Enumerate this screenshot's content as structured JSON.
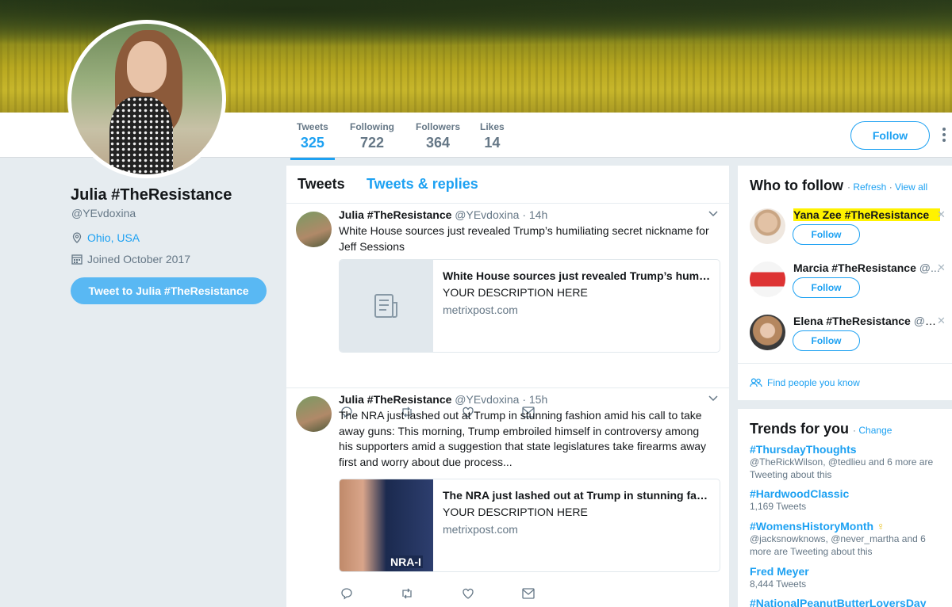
{
  "profile": {
    "name": "Julia #TheResistance",
    "handle": "@YEvdoxina",
    "location": "Ohio, USA",
    "joined": "Joined October 2017",
    "tweet_to_label": "Tweet to Julia #TheResistance"
  },
  "nav": {
    "stats": [
      {
        "label": "Tweets",
        "value": "325"
      },
      {
        "label": "Following",
        "value": "722"
      },
      {
        "label": "Followers",
        "value": "364"
      },
      {
        "label": "Likes",
        "value": "14"
      }
    ],
    "follow_label": "Follow",
    "more_icon": "more-vertical-icon"
  },
  "timeline": {
    "tabs": [
      "Tweets",
      "Tweets & replies"
    ],
    "tweets": [
      {
        "name": "Julia #TheResistance",
        "meta": "@YEvdoxina · 14h",
        "text": "White House sources just revealed Trump’s humiliating secret nickname for Jeff Sessions",
        "card": {
          "title": "White House sources just revealed Trump’s humiliating secret nickname for Jeff Sessions",
          "description": "YOUR DESCRIPTION HERE",
          "domain": "metrixpost.com"
        }
      },
      {
        "name": "Julia #TheResistance",
        "meta": "@YEvdoxina · 15h",
        "text": "The NRA just lashed out at Trump in stunning fashion amid his call to take away guns: This morning, Trump embroiled himself in controversy among his supporters amid a suggestion that state legislatures take firearms away first and worry about due process...",
        "card": {
          "title": "The NRA just lashed out at Trump in stunning fashion amid his call to take away guns",
          "description": "YOUR DESCRIPTION HERE",
          "domain": "metrixpost.com",
          "image_text": "NRA-I"
        }
      }
    ]
  },
  "who_to_follow": {
    "title": "Who to follow",
    "refresh": "Refresh",
    "view_all": "View all",
    "separator": "·",
    "follow_label": "Follow",
    "suggestions": [
      {
        "name": "Yana Zee #TheResistance",
        "handle": ""
      },
      {
        "name": "Marcia #TheResistance",
        "handle": "@..."
      },
      {
        "name": "Elena #TheResistance",
        "handle": "@El..."
      }
    ],
    "find_people": "Find people you know"
  },
  "trends": {
    "title": "Trends for you",
    "change": "Change",
    "items": [
      {
        "name": "#ThursdayThoughts",
        "detail": "@TheRickWilson, @tedlieu and 6 more are Tweeting about this"
      },
      {
        "name": "#HardwoodClassic",
        "detail": "1,169 Tweets"
      },
      {
        "name": "#WomensHistoryMonth",
        "detail": "@jacksnowknows, @never_martha and 6 more are Tweeting about this"
      },
      {
        "name": "Fred Meyer",
        "detail": "8,444 Tweets"
      },
      {
        "name": "#NationalPeanutButterLoversDay",
        "detail": ""
      }
    ]
  },
  "colors": {
    "accent": "#1da1f2",
    "highlight": "#fff200",
    "muted": "#657786"
  }
}
